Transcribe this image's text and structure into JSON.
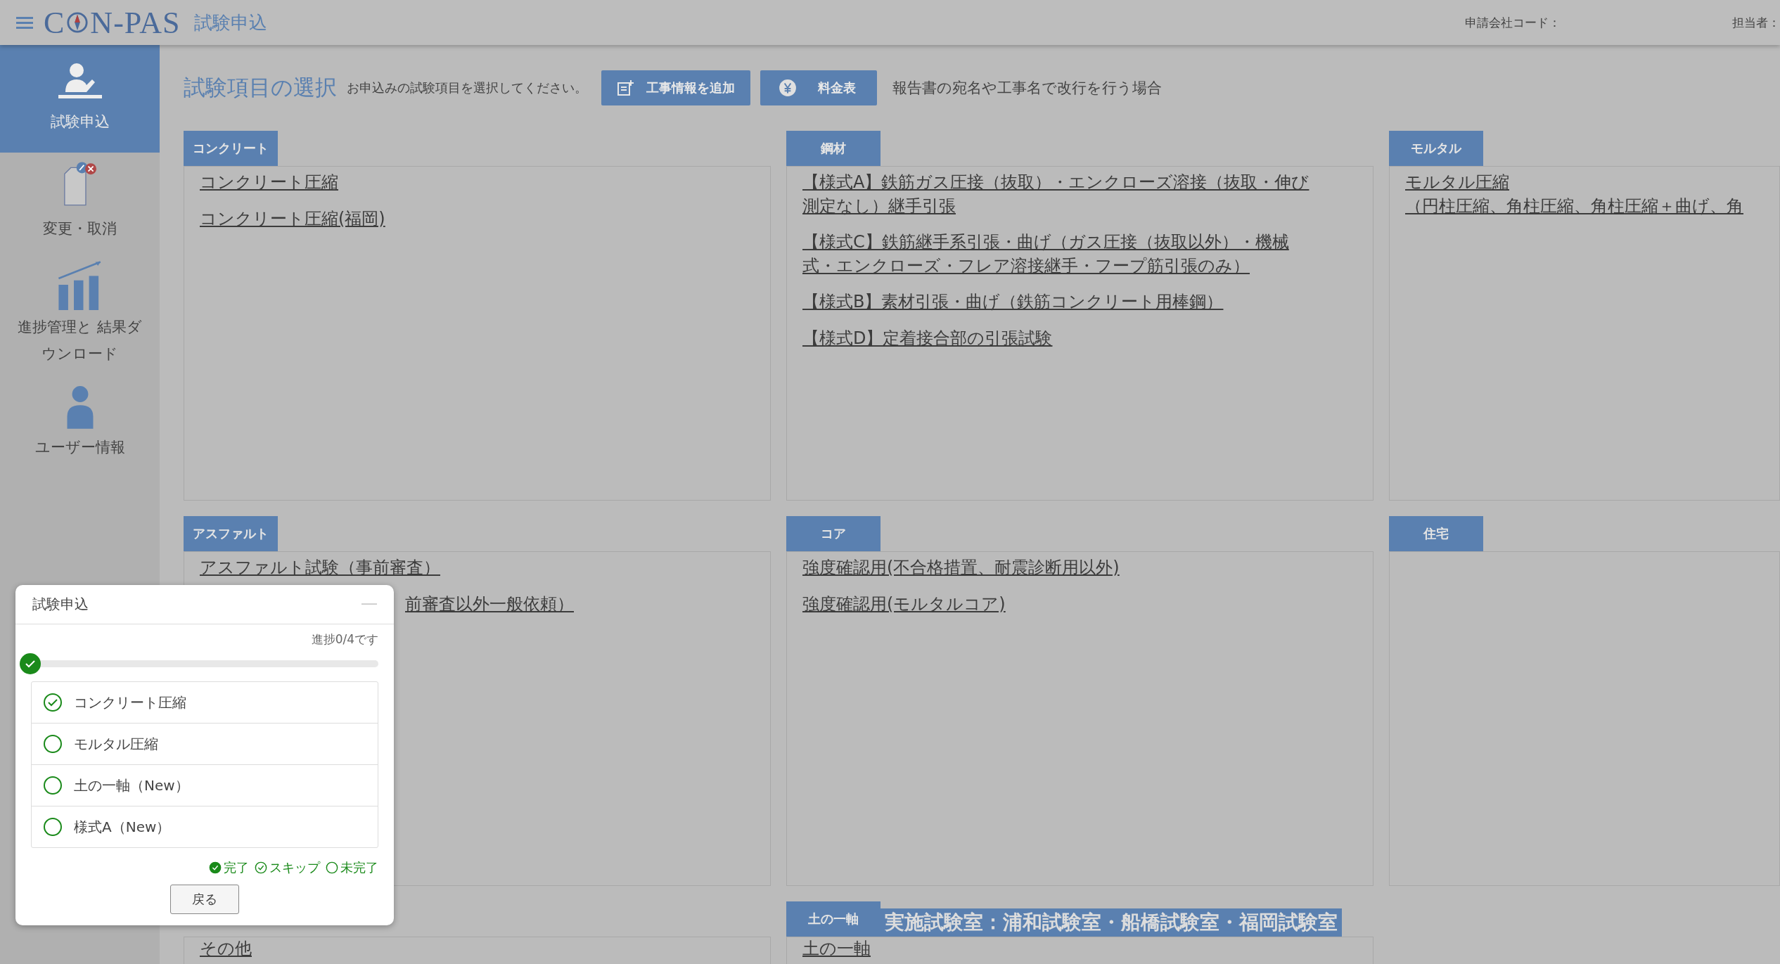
{
  "header": {
    "logo_left": "C",
    "logo_right": "N-PAS",
    "page_title": "試験申込",
    "company_code_label": "申請会社コード：",
    "person_label": "担当者："
  },
  "sidebar": {
    "items": [
      {
        "label": "試験申込",
        "kind": "apply",
        "selected": true
      },
      {
        "label": "変更・取消",
        "kind": "change",
        "selected": false
      },
      {
        "label": "進捗管理と 結果ダウンロード",
        "kind": "progress",
        "selected": false
      },
      {
        "label": "ユーザー情報",
        "kind": "user",
        "selected": false
      }
    ]
  },
  "toolbar": {
    "title": "試験項目の選択",
    "subtitle": "お申込みの試験項目を選択してください。",
    "buttons": [
      {
        "label": "工事情報を追加",
        "kind": "add"
      },
      {
        "label": "料金表",
        "kind": "fee"
      }
    ],
    "note": "報告書の宛名や工事名で改行を行う場合"
  },
  "categories": [
    {
      "label": "コンクリート",
      "items": [
        {
          "lines": [
            "コンクリート圧縮"
          ],
          "kind": "full"
        },
        {
          "lines": [
            "コンクリート圧縮(福岡)"
          ],
          "kind": "full"
        }
      ]
    },
    {
      "label": "鋼材",
      "items": [
        {
          "lines": [
            "【様式A】鉄筋ガス圧接（抜取）・エンクローズ溶接（抜取・伸び",
            "測定なし）継手引張"
          ],
          "kind": "full"
        },
        {
          "lines": [
            "【様式C】鉄筋継手系引張・曲げ（ガス圧接（抜取以外）・機械",
            "式・エンクローズ・フレア溶接継手・フープ筋引張のみ）"
          ],
          "kind": "full"
        },
        {
          "lines": [
            "【様式B】素材引張・曲げ（鉄筋コンクリート用棒鋼）"
          ],
          "kind": "full"
        },
        {
          "lines": [
            "【様式D】定着接合部の引張試験"
          ],
          "kind": "full"
        }
      ]
    },
    {
      "label": "モルタル",
      "items": [
        {
          "lines": [
            "モルタル圧縮",
            "（円柱圧縮、角柱圧縮、角柱圧縮＋曲げ、角"
          ],
          "kind": "full"
        }
      ]
    },
    {
      "label": "アスファルト",
      "items": [
        {
          "lines": [
            "アスファルト試験（事前審査）"
          ],
          "kind": "full"
        },
        {
          "lines": [
            "前審査以外一般依頼）"
          ],
          "kind": "partial"
        }
      ]
    },
    {
      "label": "コア",
      "items": [
        {
          "lines": [
            "強度確認用(不合格措置、耐震診断用以外)"
          ],
          "kind": "full"
        },
        {
          "lines": [
            "強度確認用(モルタルコア)"
          ],
          "kind": "full"
        }
      ]
    },
    {
      "label": "住宅"
    },
    {
      "items": [
        {
          "lines": [
            "その他"
          ],
          "kind": "full"
        }
      ]
    },
    {
      "label": "土の一軸",
      "note": "実施試験室：浦和試験室・船橋試験室・福岡試験室",
      "items": [
        {
          "lines": [
            "土の一軸"
          ],
          "kind": "full"
        }
      ]
    }
  ],
  "dialog": {
    "title": "試験申込",
    "progress_text": "進捗0/4です",
    "level": 0,
    "steps": [
      {
        "label": "コンクリート圧縮",
        "kind": "skipped"
      },
      {
        "label": "モルタル圧縮",
        "kind": "pending"
      },
      {
        "label": "土の一軸（New）",
        "kind": "pending"
      },
      {
        "label": "様式A（New）",
        "kind": "pending"
      }
    ],
    "legend": [
      {
        "label": "完了",
        "kind": "done"
      },
      {
        "label": "スキップ",
        "kind": "skipped"
      },
      {
        "label": "未完了",
        "kind": "pending"
      }
    ],
    "back_button": "戻る"
  }
}
